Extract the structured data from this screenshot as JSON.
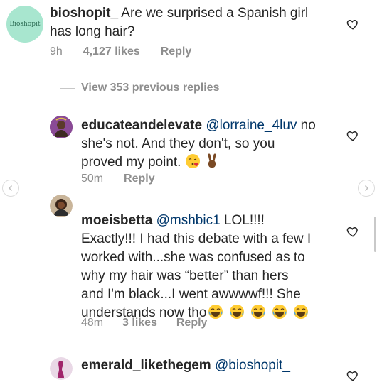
{
  "comment": {
    "avatar_text": "Bioshopit",
    "username": "bioshopit_",
    "text": "Are we surprised a Spanish girl has long hair?",
    "time": "9h",
    "likes": "4,127 likes",
    "reply": "Reply"
  },
  "view_replies": "View 353 previous replies",
  "replies": [
    {
      "username": "educateandelevate",
      "mention": "@lorraine_4luv",
      "text_line1_rest": "no",
      "text_line2": "she's not. And they don't, so you",
      "text_line3": "proved my point.",
      "time": "50m",
      "reply": "Reply"
    },
    {
      "username": "moeisbetta",
      "mention": "@mshbic1",
      "text_line1_rest": "LOL!!!!",
      "text_line2": "Exactly!!! I had this debate with a few I",
      "text_line3": "worked with...she was confused as to",
      "text_line4": "why my hair was “better” than hers",
      "text_line5": "and I'm black...I went awwwwf!!! She",
      "text_line6": "understands now tho",
      "time": "48m",
      "likes": "3 likes",
      "reply": "Reply"
    },
    {
      "username": "emerald_likethegem",
      "mention": "@bioshopit_"
    }
  ],
  "icons": {
    "heart": "heart-outline-icon",
    "prev": "chevron-left-icon",
    "next": "chevron-right-icon",
    "emoji_kiss": "face-blowing-kiss-emoji",
    "emoji_victory": "victory-hand-emoji",
    "emoji_laugh": "face-with-tears-of-joy-emoji"
  },
  "colors": {
    "text": "#262626",
    "mention": "#00376b",
    "meta": "#8e8e8e",
    "avatar_bg": "#a8e6cf"
  }
}
